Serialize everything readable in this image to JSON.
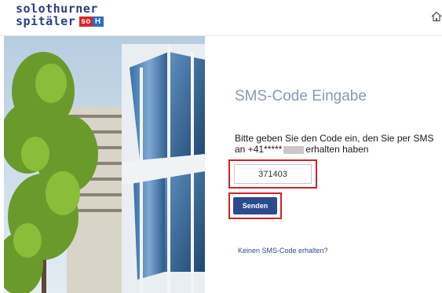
{
  "header": {
    "logo_line1": "solothurner",
    "logo_line2": "spitäler",
    "logo_badge_so": "so",
    "logo_badge_h": "H",
    "home_icon": "home-icon"
  },
  "photo": {
    "description_icon": "building-photo"
  },
  "form": {
    "title": "SMS-Code Eingabe",
    "instruction_part1": "Bitte geben Sie den Code ein, den Sie per SMS an +41*****",
    "instruction_part2": "erhalten haben",
    "code_value": "371403",
    "send_label": "Senden",
    "no_sms_link": "Keinen SMS-Code erhalten?"
  },
  "colors": {
    "brand_blue": "#2a3e84",
    "button_blue": "#2d4a8e",
    "highlight_red": "#d0222a",
    "title_gray": "#8a9bb1"
  }
}
